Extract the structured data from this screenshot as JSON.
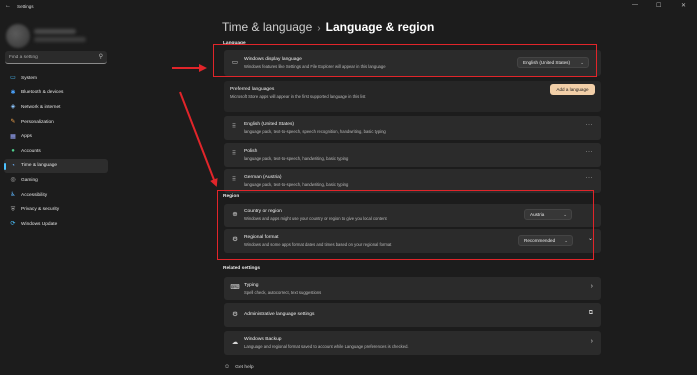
{
  "window": {
    "title": "Settings",
    "back_glyph": "←",
    "minimize_glyph": "—",
    "maximize_glyph": "☐",
    "close_glyph": "✕"
  },
  "sidebar": {
    "search_placeholder": "Find a setting",
    "search_icon": "⚲",
    "items": [
      {
        "label": "System",
        "icon": "system-icon",
        "glyph": "▭",
        "color": "#4cc2ff",
        "active": false
      },
      {
        "label": "Bluetooth & devices",
        "icon": "bluetooth-icon",
        "glyph": "✱",
        "color": "#4aa3ff",
        "active": false
      },
      {
        "label": "Network & internet",
        "icon": "network-icon",
        "glyph": "◈",
        "color": "#8ec7ff",
        "active": false
      },
      {
        "label": "Personalization",
        "icon": "brush-icon",
        "glyph": "✎",
        "color": "#f0a24a",
        "active": false
      },
      {
        "label": "Apps",
        "icon": "apps-icon",
        "glyph": "▦",
        "color": "#9aa8ff",
        "active": false
      },
      {
        "label": "Accounts",
        "icon": "account-icon",
        "glyph": "●",
        "color": "#4fd08f",
        "active": false
      },
      {
        "label": "Time & language",
        "icon": "globe-icon",
        "glyph": "◔",
        "color": "#6fb4ff",
        "active": true
      },
      {
        "label": "Gaming",
        "icon": "gaming-icon",
        "glyph": "◎",
        "color": "#bbbbbb",
        "active": false
      },
      {
        "label": "Accessibility",
        "icon": "accessibility-icon",
        "glyph": "♿",
        "color": "#5fb7ff",
        "active": false
      },
      {
        "label": "Privacy & security",
        "icon": "shield-icon",
        "glyph": "⛨",
        "color": "#a7a7a7",
        "active": false
      },
      {
        "label": "Windows Update",
        "icon": "update-icon",
        "glyph": "⟳",
        "color": "#4cc2ff",
        "active": false
      }
    ]
  },
  "header": {
    "crumb_parent": "Time & language",
    "crumb_sep": "›",
    "crumb_current": "Language & region"
  },
  "language": {
    "section_title": "Language",
    "display": {
      "title": "Windows display language",
      "desc": "Windows features like Settings and File Explorer will appear in this language",
      "value": "English (United States)"
    },
    "preferred": {
      "title": "Preferred languages",
      "desc": "Microsoft Store apps will appear in the first supported language in this list",
      "add_label": "Add a language"
    },
    "languages": [
      {
        "name": "English (United States)",
        "features": "language pack, text-to-speech, speech recognition, handwriting, basic typing"
      },
      {
        "name": "Polish",
        "features": "language pack, text-to-speech, handwriting, basic typing"
      },
      {
        "name": "German (Austria)",
        "features": "language pack, text-to-speech, handwriting, basic typing"
      }
    ]
  },
  "region": {
    "section_title": "Region",
    "country": {
      "title": "Country or region",
      "desc": "Windows and apps might use your country or region to give you local content",
      "value": "Austria"
    },
    "format": {
      "title": "Regional format",
      "desc": "Windows and some apps format dates and times based on your regional format",
      "value": "Recommended"
    }
  },
  "related": {
    "section_title": "Related settings",
    "typing": {
      "title": "Typing",
      "desc": "Spell check, autocorrect, text suggestions"
    },
    "admin": {
      "title": "Administrative language settings"
    },
    "backup": {
      "title": "Windows Backup",
      "desc": "Language and regional format saved to account while Language preferences is checked."
    }
  },
  "footer": {
    "help_label": "Get help"
  },
  "colors": {
    "accent": "#4cc2ff",
    "highlight_red": "#e1252a",
    "add_button": "#f2cfa8"
  }
}
